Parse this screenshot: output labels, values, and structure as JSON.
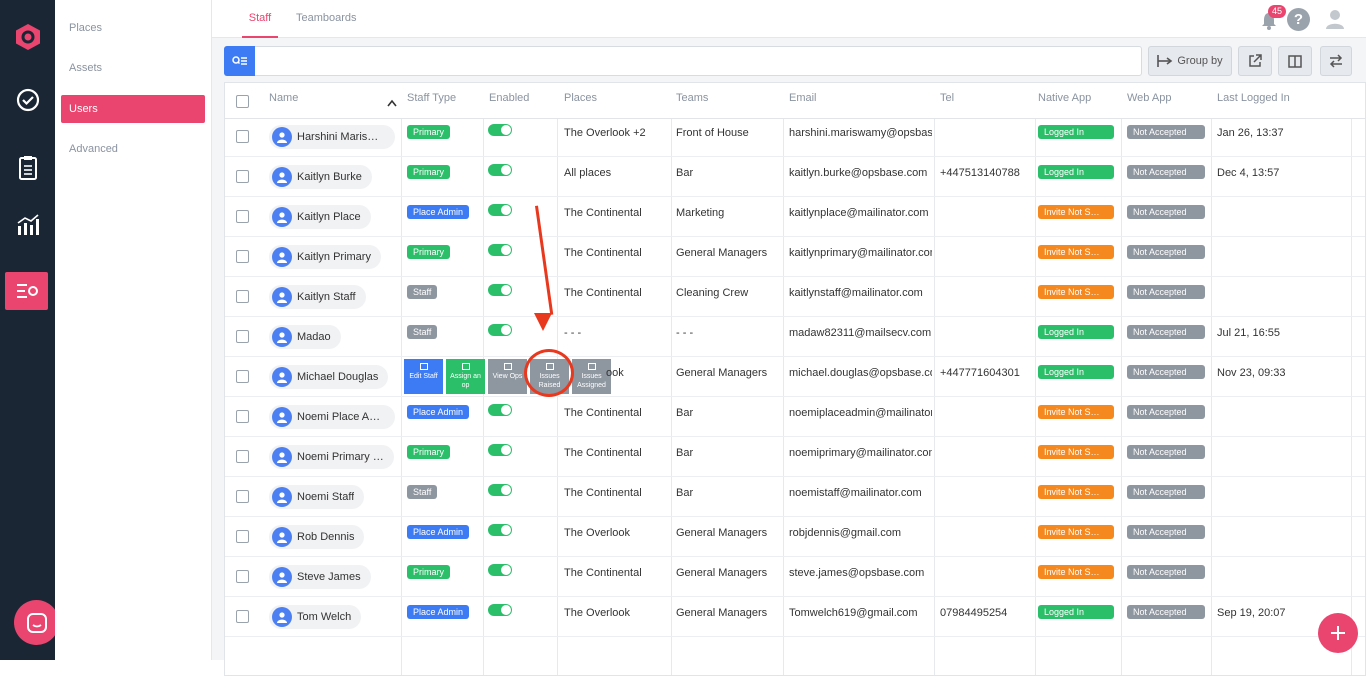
{
  "nav": {
    "items": [
      "Places",
      "Assets",
      "Users",
      "Advanced"
    ]
  },
  "tabs": [
    "Staff",
    "Teamboards"
  ],
  "notifications": {
    "count": "45"
  },
  "toolbar": {
    "group_by": "Group by",
    "search_placeholder": ""
  },
  "table": {
    "headers": [
      "Name",
      "Staff Type",
      "Enabled",
      "Places",
      "Teams",
      "Email",
      "Tel",
      "Native App",
      "Web App",
      "Last Logged In"
    ],
    "rows": [
      {
        "name": "Harshini Marisw…",
        "type": "Primary",
        "places": "The Overlook +2",
        "teams": "Front of House",
        "email": "harshini.mariswamy@opsbase.",
        "tel": "",
        "native": "Logged In",
        "web": "Not Accepted",
        "last": "Jan 26, 13:37"
      },
      {
        "name": "Kaitlyn Burke",
        "type": "Primary",
        "places": "All places",
        "teams": "Bar",
        "email": "kaitlyn.burke@opsbase.com",
        "tel": "+447513140788",
        "native": "Logged In",
        "web": "Not Accepted",
        "last": "Dec 4, 13:57"
      },
      {
        "name": "Kaitlyn Place",
        "type": "Place Admin",
        "places": "The Continental",
        "teams": "Marketing",
        "email": "kaitlynplace@mailinator.com",
        "tel": "",
        "native": "Invite Not S…",
        "web": "Not Accepted",
        "last": ""
      },
      {
        "name": "Kaitlyn Primary",
        "type": "Primary",
        "places": "The Continental",
        "teams": "General Managers",
        "email": "kaitlynprimary@mailinator.com",
        "tel": "",
        "native": "Invite Not S…",
        "web": "Not Accepted",
        "last": ""
      },
      {
        "name": "Kaitlyn Staff",
        "type": "Staff",
        "places": "The Continental",
        "teams": "Cleaning Crew",
        "email": "kaitlynstaff@mailinator.com",
        "tel": "",
        "native": "Invite Not S…",
        "web": "Not Accepted",
        "last": ""
      },
      {
        "name": "Madao",
        "type": "Staff",
        "places": "- - -",
        "teams": "- - -",
        "email": "madaw82311@mailsecv.com",
        "tel": "",
        "native": "Logged In",
        "web": "Not Accepted",
        "last": "Jul 21, 16:55"
      },
      {
        "name": "Michael Douglas",
        "type": "",
        "places": "ook",
        "teams": "General Managers",
        "email": "michael.douglas@opsbase.com",
        "tel": "+447771604301",
        "native": "Logged In",
        "web": "Not Accepted",
        "last": "Nov 23, 09:33"
      },
      {
        "name": "Noemi Place Ad…",
        "type": "Place Admin",
        "places": "The Continental",
        "teams": "Bar",
        "email": "noemiplaceadmin@mailinator.c",
        "tel": "",
        "native": "Invite Not S…",
        "web": "Not Accepted",
        "last": ""
      },
      {
        "name": "Noemi Primary …",
        "type": "Primary",
        "places": "The Continental",
        "teams": "Bar",
        "email": "noemiprimary@mailinator.com",
        "tel": "",
        "native": "Invite Not S…",
        "web": "Not Accepted",
        "last": ""
      },
      {
        "name": "Noemi Staff",
        "type": "Staff",
        "places": "The Continental",
        "teams": "Bar",
        "email": "noemistaff@mailinator.com",
        "tel": "",
        "native": "Invite Not S…",
        "web": "Not Accepted",
        "last": ""
      },
      {
        "name": "Rob Dennis",
        "type": "Place Admin",
        "places": "The Overlook",
        "teams": "General Managers",
        "email": "robjdennis@gmail.com",
        "tel": "",
        "native": "Invite Not S…",
        "web": "Not Accepted",
        "last": ""
      },
      {
        "name": "Steve James",
        "type": "Primary",
        "places": "The Continental",
        "teams": "General Managers",
        "email": "steve.james@opsbase.com",
        "tel": "",
        "native": "Invite Not S…",
        "web": "Not Accepted",
        "last": ""
      },
      {
        "name": "Tom Welch",
        "type": "Place Admin",
        "places": "The Overlook",
        "teams": "General Managers",
        "email": "Tomwelch619@gmail.com",
        "tel": "07984495254",
        "native": "Logged In",
        "web": "Not Accepted",
        "last": "Sep 19, 20:07"
      }
    ]
  },
  "row_actions": [
    {
      "label": "Edit Staff",
      "color": "#3d7bf5"
    },
    {
      "label": "Assign an op",
      "color": "#2bbf6a"
    },
    {
      "label": "View Ops",
      "color": "#8e96a0"
    },
    {
      "label": "Issues Raised",
      "color": "#8e96a0"
    },
    {
      "label": "Issues Assigned",
      "color": "#8e96a0"
    }
  ],
  "colors": {
    "accent": "#e9456f",
    "primary_chip": "#2bbf6a",
    "place_admin_chip": "#3d7bf5",
    "staff_chip": "#8e96a0",
    "logged_in": "#2bbf6a",
    "invite_not_sent": "#f5891f",
    "not_accepted": "#8e96a0"
  }
}
